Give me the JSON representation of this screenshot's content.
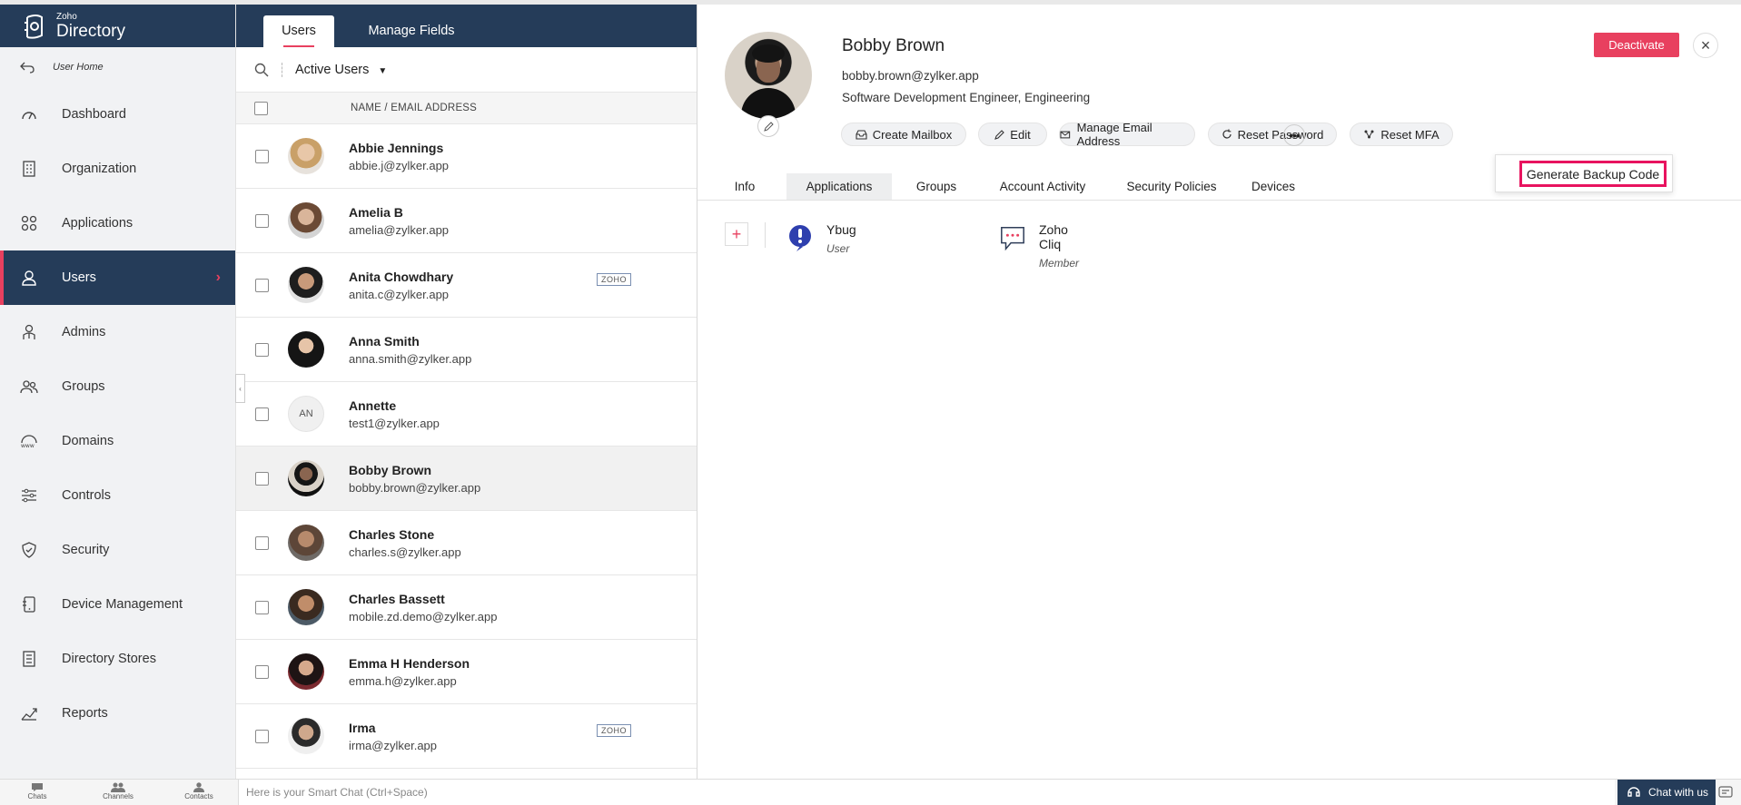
{
  "brand": {
    "small": "Zoho",
    "big": "Directory"
  },
  "sidebar": {
    "home_label": "User Home",
    "items": [
      {
        "label": "Dashboard",
        "icon": "dashboard-icon"
      },
      {
        "label": "Organization",
        "icon": "organization-icon"
      },
      {
        "label": "Applications",
        "icon": "applications-icon"
      },
      {
        "label": "Users",
        "icon": "user-icon",
        "active": true
      },
      {
        "label": "Admins",
        "icon": "admin-icon"
      },
      {
        "label": "Groups",
        "icon": "groups-icon"
      },
      {
        "label": "Domains",
        "icon": "globe-www-icon"
      },
      {
        "label": "Controls",
        "icon": "sliders-icon"
      },
      {
        "label": "Security",
        "icon": "shield-icon"
      },
      {
        "label": "Device Management",
        "icon": "device-icon"
      },
      {
        "label": "Directory Stores",
        "icon": "store-icon"
      },
      {
        "label": "Reports",
        "icon": "reports-icon"
      }
    ]
  },
  "user_list": {
    "tabs": [
      "Users",
      "Manage Fields"
    ],
    "filter_label": "Active Users",
    "column_header": "NAME / EMAIL ADDRESS",
    "users": [
      {
        "name": "Abbie Jennings",
        "email": "abbie.j@zylker.app",
        "badge": ""
      },
      {
        "name": "Amelia B",
        "email": "amelia@zylker.app",
        "badge": ""
      },
      {
        "name": "Anita Chowdhary",
        "email": "anita.c@zylker.app",
        "badge": "ZOHO"
      },
      {
        "name": "Anna Smith",
        "email": "anna.smith@zylker.app",
        "badge": ""
      },
      {
        "name": "Annette",
        "email": "test1@zylker.app",
        "badge": "",
        "initials": "AN"
      },
      {
        "name": "Bobby Brown",
        "email": "bobby.brown@zylker.app",
        "badge": "",
        "selected": true
      },
      {
        "name": "Charles Stone",
        "email": "charles.s@zylker.app",
        "badge": ""
      },
      {
        "name": "Charles Bassett",
        "email": "mobile.zd.demo@zylker.app",
        "badge": ""
      },
      {
        "name": "Emma H Henderson",
        "email": "emma.h@zylker.app",
        "badge": ""
      },
      {
        "name": "Irma",
        "email": "irma@zylker.app",
        "badge": "ZOHO"
      }
    ]
  },
  "detail": {
    "name": "Bobby Brown",
    "email": "bobby.brown@zylker.app",
    "title": "Software Development Engineer, Engineering",
    "deactivate_label": "Deactivate",
    "actions": [
      "Create Mailbox",
      "Edit",
      "Manage Email Address",
      "Reset Password",
      "Reset MFA"
    ],
    "more_menu": {
      "item": "Generate Backup Code"
    },
    "tabs": [
      "Info",
      "Applications",
      "Groups",
      "Account Activity",
      "Security Policies",
      "Devices"
    ],
    "active_tab": "Applications",
    "apps": [
      {
        "name": "Ybug",
        "role": "User",
        "icon": "ybug-icon"
      },
      {
        "name": "Zoho Cliq",
        "role": "Member",
        "icon": "cliq-chat-icon"
      }
    ]
  },
  "bottom_bar": {
    "chats": "Chats",
    "channels": "Channels",
    "contacts": "Contacts",
    "smart_chat_placeholder": "Here is your Smart Chat (Ctrl+Space)",
    "chat_with_us": "Chat with us"
  },
  "colors": {
    "navy": "#253c59",
    "accent": "#e8405f",
    "highlight": "#e8135f"
  }
}
